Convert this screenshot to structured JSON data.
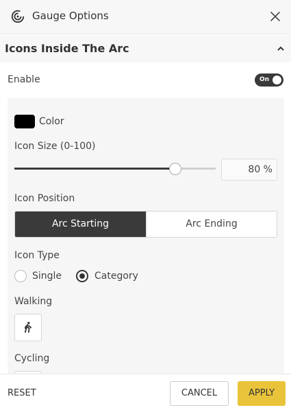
{
  "header": {
    "title": "Gauge Options",
    "logo_icon": "gauge-spiral-icon",
    "close_icon": "close-icon"
  },
  "section": {
    "title": "Icons Inside The Arc",
    "chevron_icon": "chevron-up-icon"
  },
  "enable": {
    "label": "Enable",
    "toggle_text": "On",
    "on": true
  },
  "color": {
    "label": "Color",
    "value": "#000000"
  },
  "icon_size": {
    "label": "Icon Size (0-100)",
    "value": 80,
    "display": "80 %"
  },
  "icon_position": {
    "label": "Icon Position",
    "options": [
      "Arc Starting",
      "Arc Ending"
    ],
    "selected": "Arc Starting"
  },
  "icon_type": {
    "label": "Icon Type",
    "options": [
      "Single",
      "Category"
    ],
    "selected": "Category"
  },
  "categories": [
    {
      "label": "Walking",
      "icon": "walking-person-icon"
    },
    {
      "label": "Cycling",
      "icon": "cycling-icon"
    }
  ],
  "footer": {
    "reset": "RESET",
    "cancel": "CANCEL",
    "apply": "APPLY"
  },
  "colors": {
    "accent": "#e9c43b",
    "dark": "#3a3a3a",
    "panel": "#f6f6f6"
  }
}
